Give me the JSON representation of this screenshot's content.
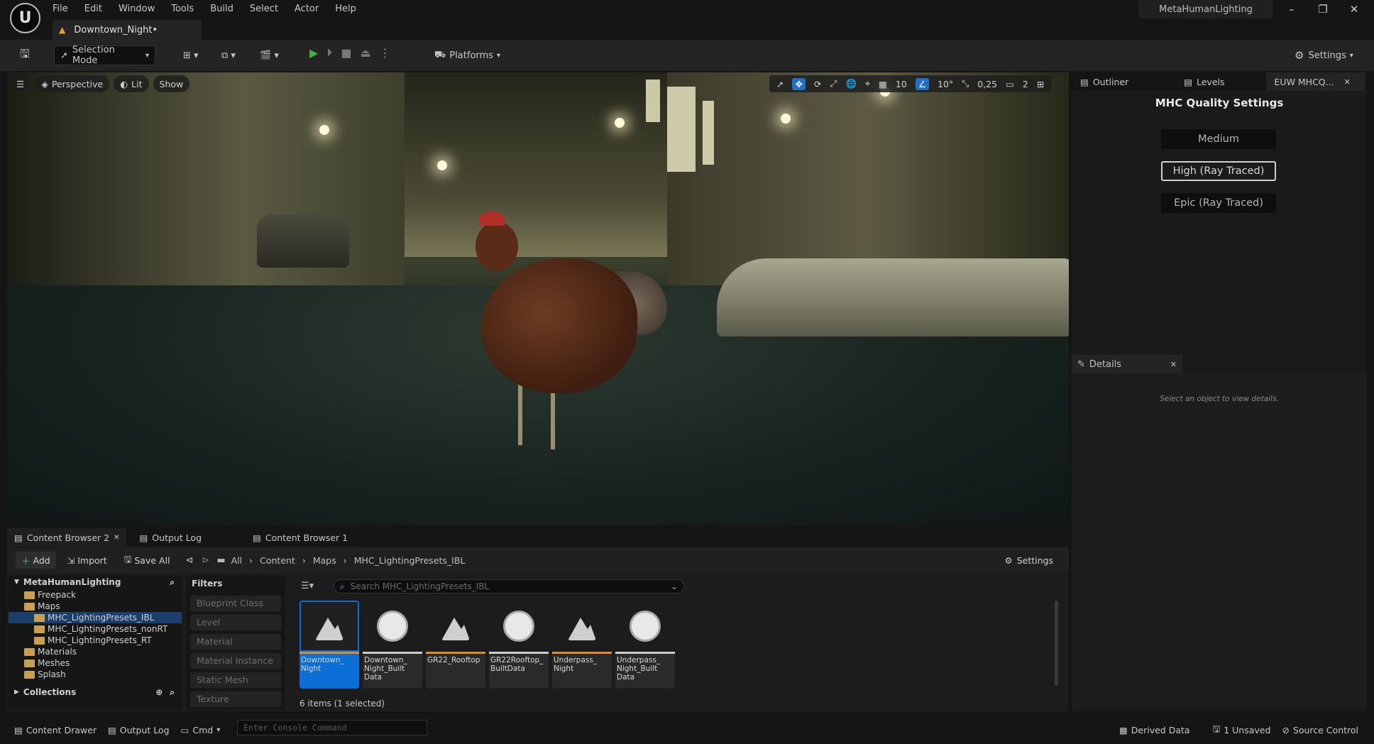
{
  "window": {
    "project_name": "MetaHumanLighting",
    "doc_tab": "Downtown_Night•",
    "controls": [
      "–",
      "❐",
      "✕"
    ]
  },
  "menu": [
    "File",
    "Edit",
    "Window",
    "Tools",
    "Build",
    "Select",
    "Actor",
    "Help"
  ],
  "toolbar": {
    "selection_mode": "Selection Mode",
    "platforms": "Platforms",
    "settings": "Settings"
  },
  "viewport": {
    "perspective": "Perspective",
    "lit": "Lit",
    "show": "Show",
    "grid_snap": "10",
    "rot_snap": "10°",
    "scale_snap": "0,25",
    "camera_speed": "2"
  },
  "right_panel": {
    "tabs": [
      "Outliner",
      "Levels",
      "EUW MHCQ..."
    ],
    "title": "MHC Quality Settings",
    "buttons": [
      "Medium",
      "High (Ray Traced)",
      "Epic (Ray Traced)"
    ],
    "details_tab": "Details",
    "details_empty": "Select an object to view details."
  },
  "content_browser": {
    "tabs": [
      "Content Browser 2",
      "Output Log",
      "Content Browser 1"
    ],
    "add": "Add",
    "import": "Import",
    "save_all": "Save All",
    "breadcrumb": [
      "All",
      "Content",
      "Maps",
      "MHC_LightingPresets_IBL"
    ],
    "settings": "Settings",
    "tree_root": "MetaHumanLighting",
    "tree": [
      {
        "label": "Freepack",
        "indent": 1,
        "selected": false
      },
      {
        "label": "Maps",
        "indent": 1,
        "selected": false
      },
      {
        "label": "MHC_LightingPresets_IBL",
        "indent": 2,
        "selected": true
      },
      {
        "label": "MHC_LightingPresets_nonRT",
        "indent": 2,
        "selected": false
      },
      {
        "label": "MHC_LightingPresets_RT",
        "indent": 2,
        "selected": false
      },
      {
        "label": "Materials",
        "indent": 1,
        "selected": false
      },
      {
        "label": "Meshes",
        "indent": 1,
        "selected": false
      },
      {
        "label": "Splash",
        "indent": 1,
        "selected": false
      }
    ],
    "collections": "Collections",
    "filters_title": "Filters",
    "filters": [
      "Blueprint Class",
      "Level",
      "Material",
      "Material Instance",
      "Static Mesh",
      "Texture"
    ],
    "search_placeholder": "Search MHC_LightingPresets_IBL",
    "assets": [
      {
        "label": "Downtown_ Night",
        "kind": "level",
        "bar": "#e08a2e",
        "selected": true
      },
      {
        "label": "Downtown_ Night_Built Data",
        "kind": "data",
        "bar": "#cccccc",
        "selected": false
      },
      {
        "label": "GR22_Rooftop",
        "kind": "level",
        "bar": "#e08a2e",
        "selected": false
      },
      {
        "label": "GR22Rooftop_ BuiltData",
        "kind": "data",
        "bar": "#cccccc",
        "selected": false
      },
      {
        "label": "Underpass_ Night",
        "kind": "level",
        "bar": "#e08a2e",
        "selected": false
      },
      {
        "label": "Underpass_ Night_Built Data",
        "kind": "data",
        "bar": "#cccccc",
        "selected": false
      }
    ],
    "count": "6 items (1 selected)"
  },
  "statusbar": {
    "content_drawer": "Content Drawer",
    "output_log": "Output Log",
    "cmd": "Cmd",
    "console_placeholder": "Enter Console Command",
    "derived_data": "Derived Data",
    "unsaved": "1 Unsaved",
    "source_control": "Source Control"
  }
}
